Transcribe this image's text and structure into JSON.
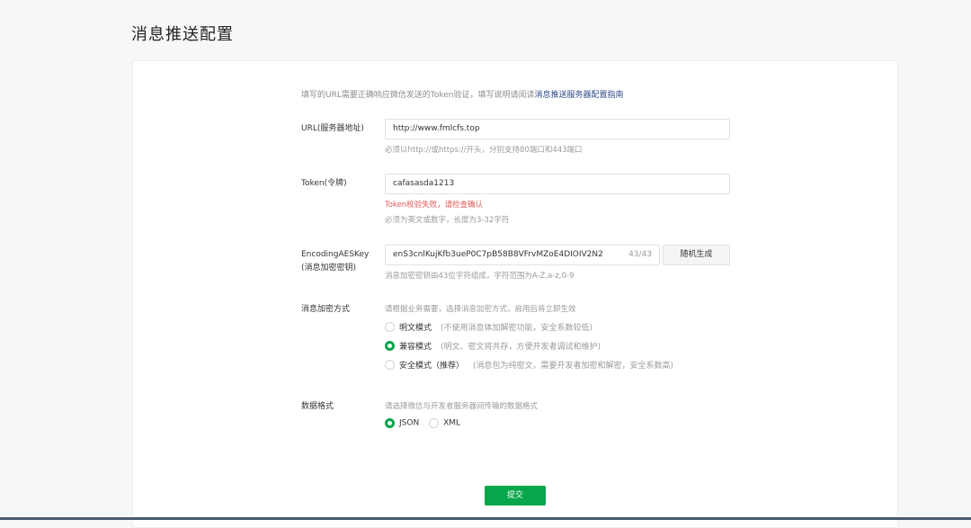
{
  "page": {
    "title": "消息推送配置"
  },
  "intro": {
    "text": "填写的URL需要正确响应微信发送的Token验证，填写说明请阅读",
    "link": "消息推送服务器配置指南"
  },
  "url": {
    "label": "URL(服务器地址)",
    "value": "http://www.fmlcfs.top",
    "hint": "必须以http://或https://开头，分别支持80端口和443端口"
  },
  "token": {
    "label": "Token(令牌)",
    "value": "cafasasda1213",
    "error": "Token校验失败，请检查确认",
    "hint": "必须为英文或数字，长度为3-32字符"
  },
  "aes": {
    "label_line1": "EncodingAESKey",
    "label_line2": "(消息加密密钥)",
    "value": "enS3cnlKujKfb3ueP0C7pB58B8VFrvMZoE4DIOIV2N2",
    "counter": "43/43",
    "generate_label": "随机生成",
    "hint": "消息加密密钥由43位字符组成，字符范围为A-Z,a-z,0-9"
  },
  "encryption": {
    "label": "消息加密方式",
    "hint": "请根据业务需要，选择消息加密方式，启用后将立即生效",
    "options": [
      {
        "label": "明文模式",
        "desc": "(不使用消息体加解密功能，安全系数较低)",
        "checked": false
      },
      {
        "label": "兼容模式",
        "desc": "(明文、密文将共存，方便开发者调试和维护)",
        "checked": true
      },
      {
        "label": "安全模式（推荐）",
        "desc": "(消息包为纯密文，需要开发者加密和解密，安全系数高)",
        "checked": false
      }
    ]
  },
  "format": {
    "label": "数据格式",
    "hint": "请选择微信与开发者服务器间传输的数据格式",
    "options": [
      {
        "label": "JSON",
        "checked": true
      },
      {
        "label": "XML",
        "checked": false
      }
    ]
  },
  "submit_label": "提交",
  "colors": {
    "accent": "#07a64a",
    "error": "#e05b5b",
    "link": "#2f4a86"
  }
}
